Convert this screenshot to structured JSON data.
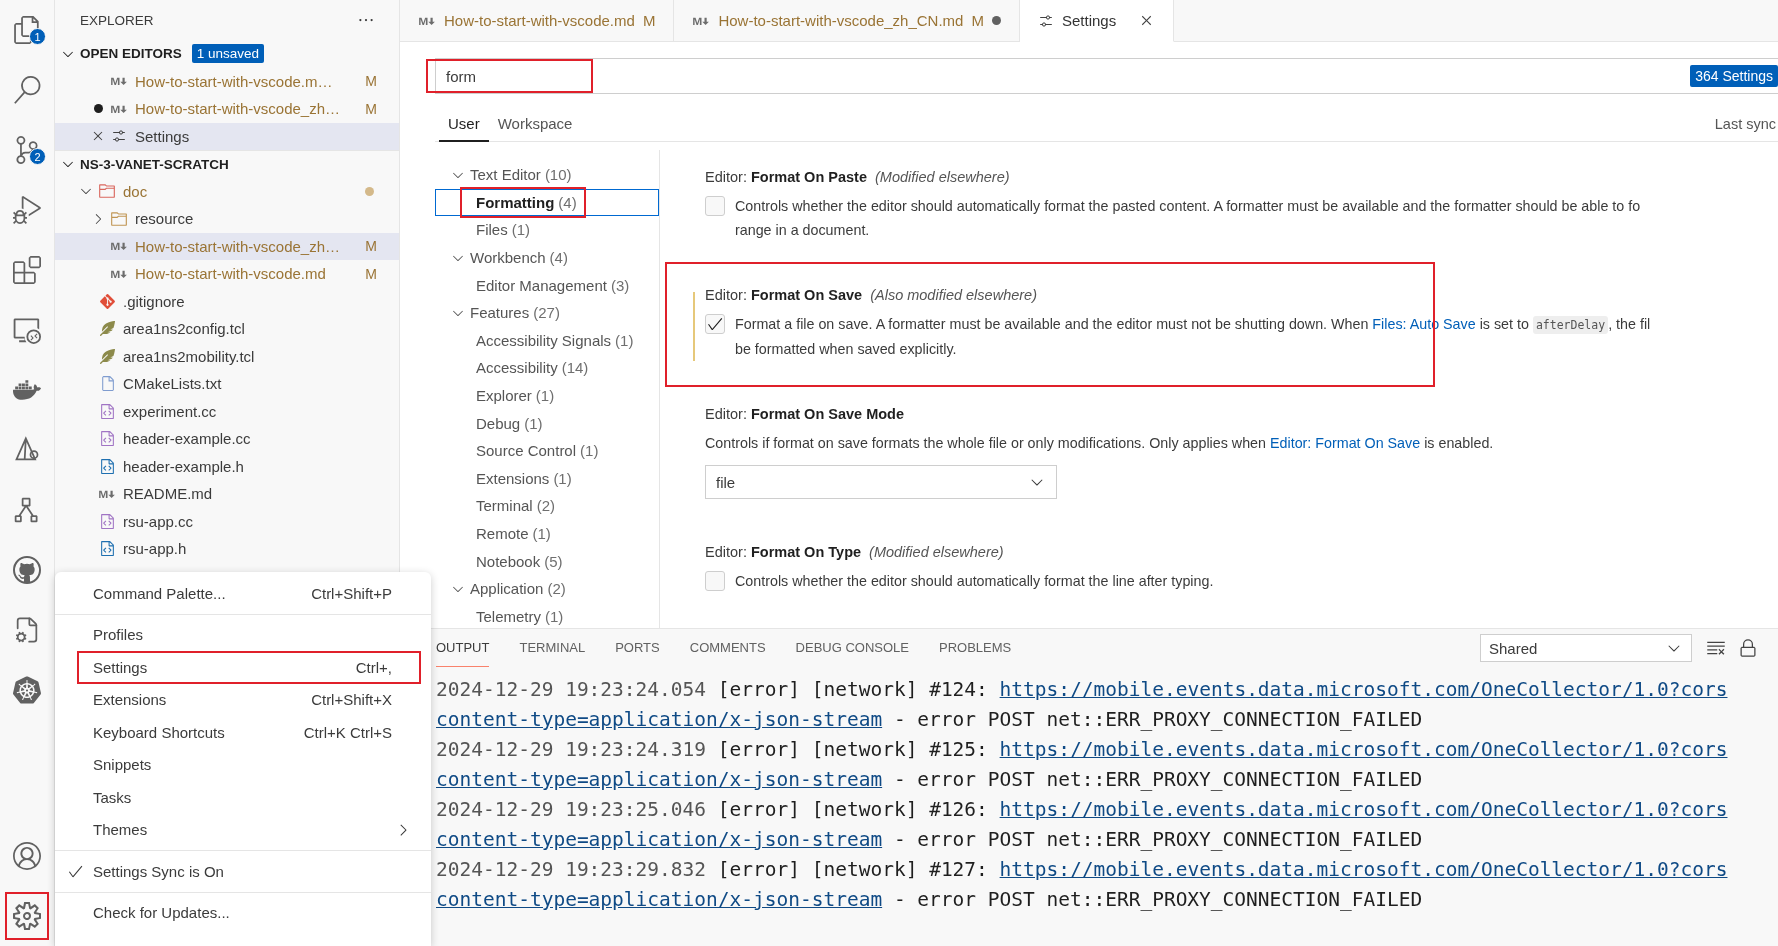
{
  "activity_bar": {
    "top": [
      {
        "kind": "files",
        "badge": "1"
      },
      {
        "kind": "search"
      },
      {
        "kind": "source-control",
        "badge": "2"
      },
      {
        "kind": "run-debug"
      },
      {
        "kind": "extensions"
      },
      {
        "kind": "remote"
      },
      {
        "kind": "docker"
      },
      {
        "kind": "triangle"
      },
      {
        "kind": "hierarchy"
      },
      {
        "kind": "github"
      },
      {
        "kind": "file-gear"
      },
      {
        "kind": "helm"
      }
    ],
    "bottom": [
      {
        "kind": "account",
        "highlighted": false
      },
      {
        "kind": "manage",
        "highlighted": true
      }
    ]
  },
  "sidebar": {
    "title": "EXPLORER",
    "sections": [
      {
        "kind": "open-editors",
        "title": "OPEN EDITORS",
        "expanded": true,
        "badge": "1 unsaved",
        "items": [
          {
            "name": "How-to-start-with-vscode.m…",
            "kind": "markdown",
            "status": "M",
            "modified": true,
            "dirty": false,
            "selected": false
          },
          {
            "name": "How-to-start-with-vscode_zh…",
            "kind": "markdown",
            "status": "M",
            "modified": true,
            "dirty": true,
            "selected": false
          },
          {
            "name": "Settings",
            "kind": "settings",
            "modified": false,
            "dirty": false,
            "selected": true
          }
        ]
      },
      {
        "kind": "folder",
        "title": "NS-3-VANET-SCRATCH",
        "expanded": true,
        "items": [
          {
            "name": "doc",
            "kind": "doc-folder",
            "expanded": true,
            "modified": true,
            "has_changes": true,
            "selected": false,
            "children": [
              {
                "name": "resource",
                "kind": "folder",
                "expanded": false,
                "modified": false,
                "selected": false
              },
              {
                "name": "How-to-start-with-vscode_zh…",
                "kind": "markdown",
                "status": "M",
                "modified": true,
                "selected": true
              },
              {
                "name": "How-to-start-with-vscode.md",
                "kind": "markdown",
                "status": "M",
                "modified": true,
                "selected": false
              }
            ]
          },
          {
            "name": ".gitignore",
            "kind": "git",
            "modified": false,
            "selected": false
          },
          {
            "name": "area1ns2config.tcl",
            "kind": "tcl",
            "modified": false,
            "selected": false
          },
          {
            "name": "area1ns2mobility.tcl",
            "kind": "tcl",
            "modified": false,
            "selected": false
          },
          {
            "name": "CMakeLists.txt",
            "kind": "text",
            "modified": false,
            "selected": false
          },
          {
            "name": "experiment.cc",
            "kind": "cpp",
            "modified": false,
            "selected": false
          },
          {
            "name": "header-example.cc",
            "kind": "cpp",
            "modified": false,
            "selected": false
          },
          {
            "name": "header-example.h",
            "kind": "header",
            "modified": false,
            "selected": false
          },
          {
            "name": "README.md",
            "kind": "markdown",
            "modified": false,
            "selected": false
          },
          {
            "name": "rsu-app.cc",
            "kind": "cpp",
            "modified": false,
            "selected": false
          },
          {
            "name": "rsu-app.h",
            "kind": "header",
            "modified": false,
            "selected": false
          }
        ]
      }
    ]
  },
  "editor_tabs": [
    {
      "title": "How-to-start-with-vscode.md",
      "kind": "markdown",
      "status": "M",
      "dirty": false,
      "selected": false
    },
    {
      "title": "How-to-start-with-vscode_zh_CN.md",
      "kind": "markdown",
      "status": "M",
      "dirty": true,
      "selected": false
    },
    {
      "title": "Settings",
      "kind": "settings",
      "dirty": false,
      "selected": true
    }
  ],
  "settings": {
    "search": {
      "value": "form",
      "highlighted": true,
      "count": "364 Settings"
    },
    "scope_tabs": [
      {
        "label": "User",
        "selected": true
      },
      {
        "label": "Workspace",
        "selected": false
      }
    ],
    "sync_status": "Last sync",
    "toc": [
      {
        "label": "Text Editor",
        "count": "(10)",
        "expanded": true,
        "selected": false,
        "children": [
          {
            "label": "Formatting",
            "count": "(4)",
            "selected": true,
            "highlighted": true
          },
          {
            "label": "Files",
            "count": "(1)",
            "selected": false
          }
        ]
      },
      {
        "label": "Workbench",
        "count": "(4)",
        "expanded": true,
        "selected": false,
        "children": [
          {
            "label": "Editor Management",
            "count": "(3)",
            "selected": false
          }
        ]
      },
      {
        "label": "Features",
        "count": "(27)",
        "expanded": true,
        "selected": false,
        "children": [
          {
            "label": "Accessibility Signals",
            "count": "(1)",
            "selected": false
          },
          {
            "label": "Accessibility",
            "count": "(14)",
            "selected": false
          },
          {
            "label": "Explorer",
            "count": "(1)",
            "selected": false
          },
          {
            "label": "Debug",
            "count": "(1)",
            "selected": false
          },
          {
            "label": "Source Control",
            "count": "(1)",
            "selected": false
          },
          {
            "label": "Extensions",
            "count": "(1)",
            "selected": false
          },
          {
            "label": "Terminal",
            "count": "(2)",
            "selected": false
          },
          {
            "label": "Remote",
            "count": "(1)",
            "selected": false
          },
          {
            "label": "Notebook",
            "count": "(5)",
            "selected": false
          }
        ]
      },
      {
        "label": "Application",
        "count": "(2)",
        "expanded": true,
        "selected": false,
        "children": [
          {
            "label": "Telemetry",
            "count": "(1)",
            "selected": false
          }
        ]
      }
    ],
    "items": [
      {
        "kind": "checkbox",
        "category": "Editor:",
        "title": "Format On Paste",
        "note": "(Modified elsewhere)",
        "checked": false,
        "modified": false,
        "highlighted": false,
        "description": [
          [
            {
              "kind": "text",
              "text": "Controls whether the editor should automatically format the pasted content. A formatter must be available and the formatter should be able to fo"
            }
          ],
          [
            {
              "kind": "text",
              "text": "range in a document."
            }
          ]
        ]
      },
      {
        "kind": "checkbox",
        "category": "Editor:",
        "title": "Format On Save",
        "note": "(Also modified elsewhere)",
        "checked": true,
        "modified": true,
        "highlighted": true,
        "description": [
          [
            {
              "kind": "text",
              "text": "Format a file on save. A formatter must be available and the editor must not be shutting down. When "
            },
            {
              "kind": "link",
              "text": "Files: Auto Save"
            },
            {
              "kind": "text",
              "text": " is set to "
            },
            {
              "kind": "code",
              "text": "afterDelay"
            },
            {
              "kind": "text",
              "text": ", the fil"
            }
          ],
          [
            {
              "kind": "text",
              "text": "be formatted when saved explicitly."
            }
          ]
        ]
      },
      {
        "kind": "dropdown",
        "category": "Editor:",
        "title": "Format On Save Mode",
        "modified": false,
        "highlighted": false,
        "value": "file",
        "description": [
          [
            {
              "kind": "text",
              "text": "Controls if format on save formats the whole file or only modifications. Only applies when "
            },
            {
              "kind": "link",
              "text": "Editor: Format On Save"
            },
            {
              "kind": "text",
              "text": " is enabled."
            }
          ]
        ]
      },
      {
        "kind": "checkbox",
        "category": "Editor:",
        "title": "Format On Type",
        "note": "(Modified elsewhere)",
        "checked": false,
        "modified": false,
        "highlighted": false,
        "description": [
          [
            {
              "kind": "text",
              "text": "Controls whether the editor should automatically format the line after typing."
            }
          ]
        ]
      }
    ]
  },
  "panel": {
    "tabs": [
      {
        "label": "OUTPUT",
        "selected": true
      },
      {
        "label": "TERMINAL",
        "selected": false
      },
      {
        "label": "PORTS",
        "selected": false
      },
      {
        "label": "COMMENTS",
        "selected": false
      },
      {
        "label": "DEBUG CONSOLE",
        "selected": false
      },
      {
        "label": "PROBLEMS",
        "selected": false
      }
    ],
    "channel": "Shared",
    "log": [
      {
        "time": "2024-12-29 19:23:24.054",
        "level": "[error]",
        "category": "[network]",
        "id": "#124:",
        "url": "https://mobile.events.data.microsoft.com/OneCollector/1.0?cors",
        "url_continued": "content-type=application/x-json-stream",
        "message": "- error POST net::ERR_PROXY_CONNECTION_FAILED"
      },
      {
        "time": "2024-12-29 19:23:24.319",
        "level": "[error]",
        "category": "[network]",
        "id": "#125:",
        "url": "https://mobile.events.data.microsoft.com/OneCollector/1.0?cors",
        "url_continued": "content-type=application/x-json-stream",
        "message": "- error POST net::ERR_PROXY_CONNECTION_FAILED"
      },
      {
        "time": "2024-12-29 19:23:25.046",
        "level": "[error]",
        "category": "[network]",
        "id": "#126:",
        "url": "https://mobile.events.data.microsoft.com/OneCollector/1.0?cors",
        "url_continued": "content-type=application/x-json-stream",
        "message": "- error POST net::ERR_PROXY_CONNECTION_FAILED"
      },
      {
        "time": "2024-12-29 19:23:29.832",
        "level": "[error]",
        "category": "[network]",
        "id": "#127:",
        "url": "https://mobile.events.data.microsoft.com/OneCollector/1.0?cors",
        "url_continued": "content-type=application/x-json-stream",
        "message": "- error POST net::ERR_PROXY_CONNECTION_FAILED"
      }
    ]
  },
  "menu": {
    "groups": [
      [
        {
          "label": "Command Palette...",
          "shortcut": "Ctrl+Shift+P",
          "kind": "command"
        }
      ],
      [
        {
          "label": "Profiles",
          "kind": "command"
        },
        {
          "label": "Settings",
          "shortcut": "Ctrl+,",
          "kind": "command",
          "highlighted": true
        },
        {
          "label": "Extensions",
          "shortcut": "Ctrl+Shift+X",
          "kind": "command"
        },
        {
          "label": "Keyboard Shortcuts",
          "shortcut": "Ctrl+K Ctrl+S",
          "kind": "command"
        },
        {
          "label": "Snippets",
          "kind": "command"
        },
        {
          "label": "Tasks",
          "kind": "command"
        },
        {
          "label": "Themes",
          "kind": "submenu"
        }
      ],
      [
        {
          "label": "Settings Sync is On",
          "kind": "toggle",
          "checked": true
        }
      ],
      [
        {
          "label": "Check for Updates...",
          "kind": "command"
        }
      ]
    ]
  }
}
